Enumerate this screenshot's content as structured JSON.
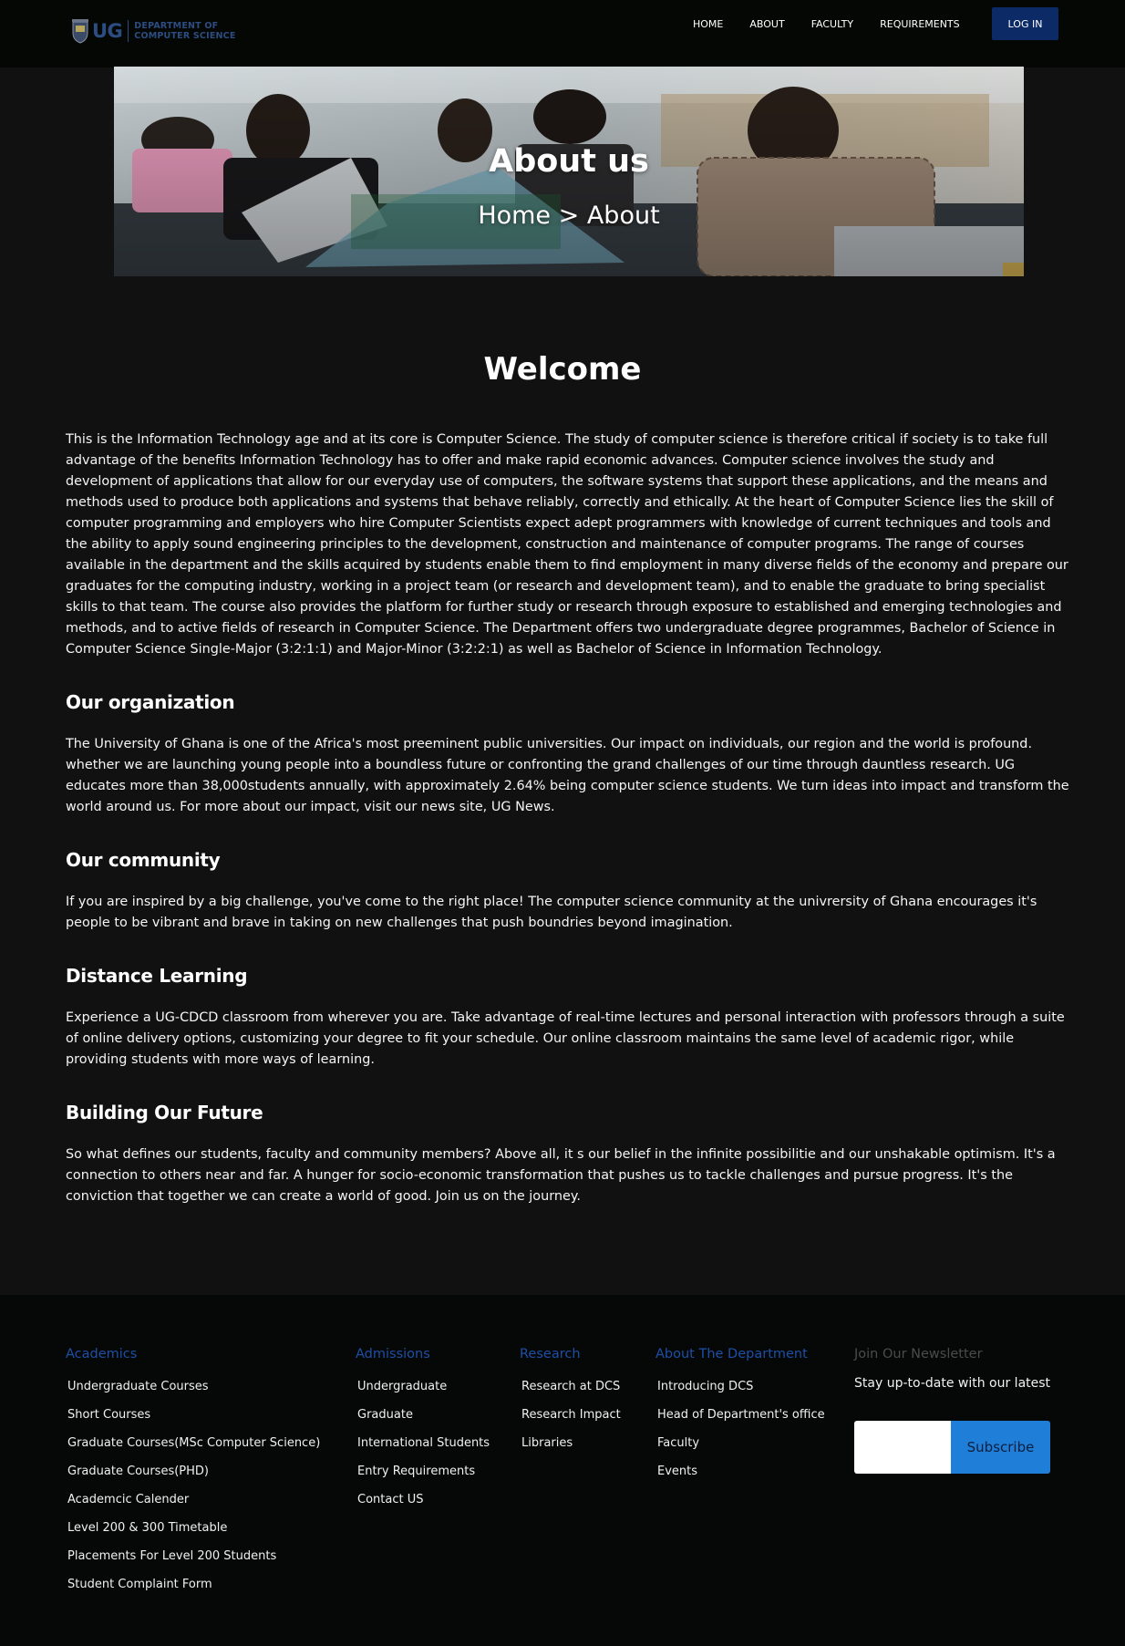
{
  "logo": {
    "short": "UG",
    "dept_line1": "Department of",
    "dept_line2": "Computer Science"
  },
  "nav": {
    "links": [
      "HOME",
      "ABOUT",
      "FACULTY",
      "REQUIREMENTS"
    ],
    "login_label": "LOG IN"
  },
  "hero": {
    "title": "About us",
    "breadcrumb": "Home  >  About"
  },
  "main": {
    "welcome": "Welcome",
    "intro": "This is the Information Technology age and at its core is Computer Science. The study of computer science is therefore critical if society is to take full advantage of the benefits Information Technology has to offer and make rapid economic advances. Computer science involves the study and development of applications that allow for our everyday use of computers, the software systems that support these applications, and the means and methods used to produce both applications and systems that behave reliably, correctly and ethically. At the heart of Computer Science lies the skill of computer programming and employers who hire Computer Scientists expect adept programmers with knowledge of current techniques and tools and the ability to apply sound engineering principles to the development, construction and maintenance of computer programs. The range of courses available in the department and the skills acquired by students enable them to find employment in many diverse fields of the economy and prepare our graduates for the computing industry, working in a project team (or research and development team), and to enable the graduate to bring specialist skills to that team. The course also provides the platform for further study or research through exposure to established and emerging technologies and methods, and to active fields of research in Computer Science. The Department offers two undergraduate degree programmes, Bachelor of Science in Computer Science Single-Major (3:2:1:1) and Major-Minor (3:2:2:1) as well as Bachelor of Science in Information Technology.",
    "sections": [
      {
        "heading": "Our organization",
        "text": "The University of Ghana is one of the Africa's most preeminent public universities. Our impact on individuals, our region and the world is profound. whether we are launching young people into a boundless future or confronting the grand challenges of our time through dauntless research. UG educates more than 38,000students annually, with approximately 2.64% being computer science students. We turn ideas into impact and transform the world around us. For more about our impact, visit our news site, UG News."
      },
      {
        "heading": "Our community",
        "text": "If you are inspired by a big challenge, you've come to the right place! The computer science community at the univrersity of Ghana encourages it's people to be vibrant and brave in taking on new challenges that push boundries beyond imagination."
      },
      {
        "heading": "Distance Learning",
        "text": "Experience a UG-CDCD classroom from wherever you are. Take advantage of real-time lectures and personal interaction with professors through a suite of online delivery options, customizing your degree to fit your schedule. Our online classroom maintains the same level of academic rigor, while providing students with more ways of learning."
      },
      {
        "heading": "Building Our Future",
        "text": "So what defines our students, faculty and community members? Above all, it  s our belief in the infinite possibilitie and our unshakable optimism. It's a connection to others near and far. A hunger for socio-economic transformation that pushes us to tackle challenges and pursue progress. It's the conviction that together we can create a world of good. Join us on the journey."
      }
    ]
  },
  "footer": {
    "academics": {
      "heading": "Academics",
      "links": [
        "Undergraduate Courses",
        "Short Courses",
        "Graduate Courses(MSc Computer Science)",
        "Graduate Courses(PHD)",
        "Academcic Calender",
        "Level 200 & 300 Timetable",
        "Placements For Level 200 Students",
        "Student Complaint Form"
      ]
    },
    "admissions": {
      "heading": "Admissions",
      "links": [
        "Undergraduate",
        "Graduate",
        "International Students",
        "Entry Requirements",
        "Contact US"
      ]
    },
    "research": {
      "heading": "Research",
      "links": [
        "Research at DCS",
        "Research Impact",
        "Libraries"
      ]
    },
    "about": {
      "heading": "About The Department",
      "links": [
        "Introducing DCS",
        "Head of Department's office",
        "Faculty",
        "Events"
      ]
    },
    "newsletter": {
      "heading": "Join Our Newsletter",
      "text": "Stay up-to-date with our latest",
      "input_placeholder": "",
      "subscribe_label": "Subscribe"
    }
  }
}
